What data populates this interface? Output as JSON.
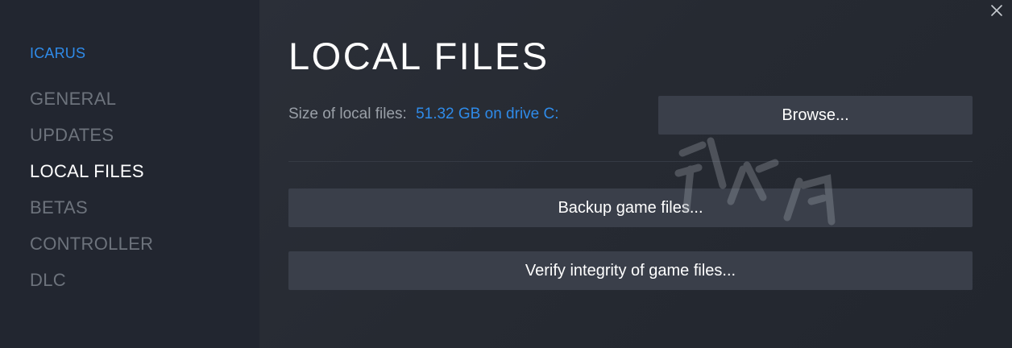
{
  "sidebar": {
    "game_title": "ICARUS",
    "items": [
      {
        "label": "GENERAL",
        "active": false
      },
      {
        "label": "UPDATES",
        "active": false
      },
      {
        "label": "LOCAL FILES",
        "active": true
      },
      {
        "label": "BETAS",
        "active": false
      },
      {
        "label": "CONTROLLER",
        "active": false
      },
      {
        "label": "DLC",
        "active": false
      }
    ]
  },
  "main": {
    "title": "LOCAL FILES",
    "size_label": "Size of local files:",
    "size_value": "51.32 GB on drive C:",
    "browse_label": "Browse...",
    "backup_label": "Backup game files...",
    "verify_label": "Verify integrity of game files..."
  },
  "window": {
    "close_icon": "close-icon"
  },
  "colors": {
    "accent": "#2f8be9",
    "sidebar_bg": "#222630",
    "main_bg": "#292d36",
    "button_bg": "#3a3f4a",
    "inactive_text": "#6d737c",
    "active_text": "#ffffff"
  }
}
